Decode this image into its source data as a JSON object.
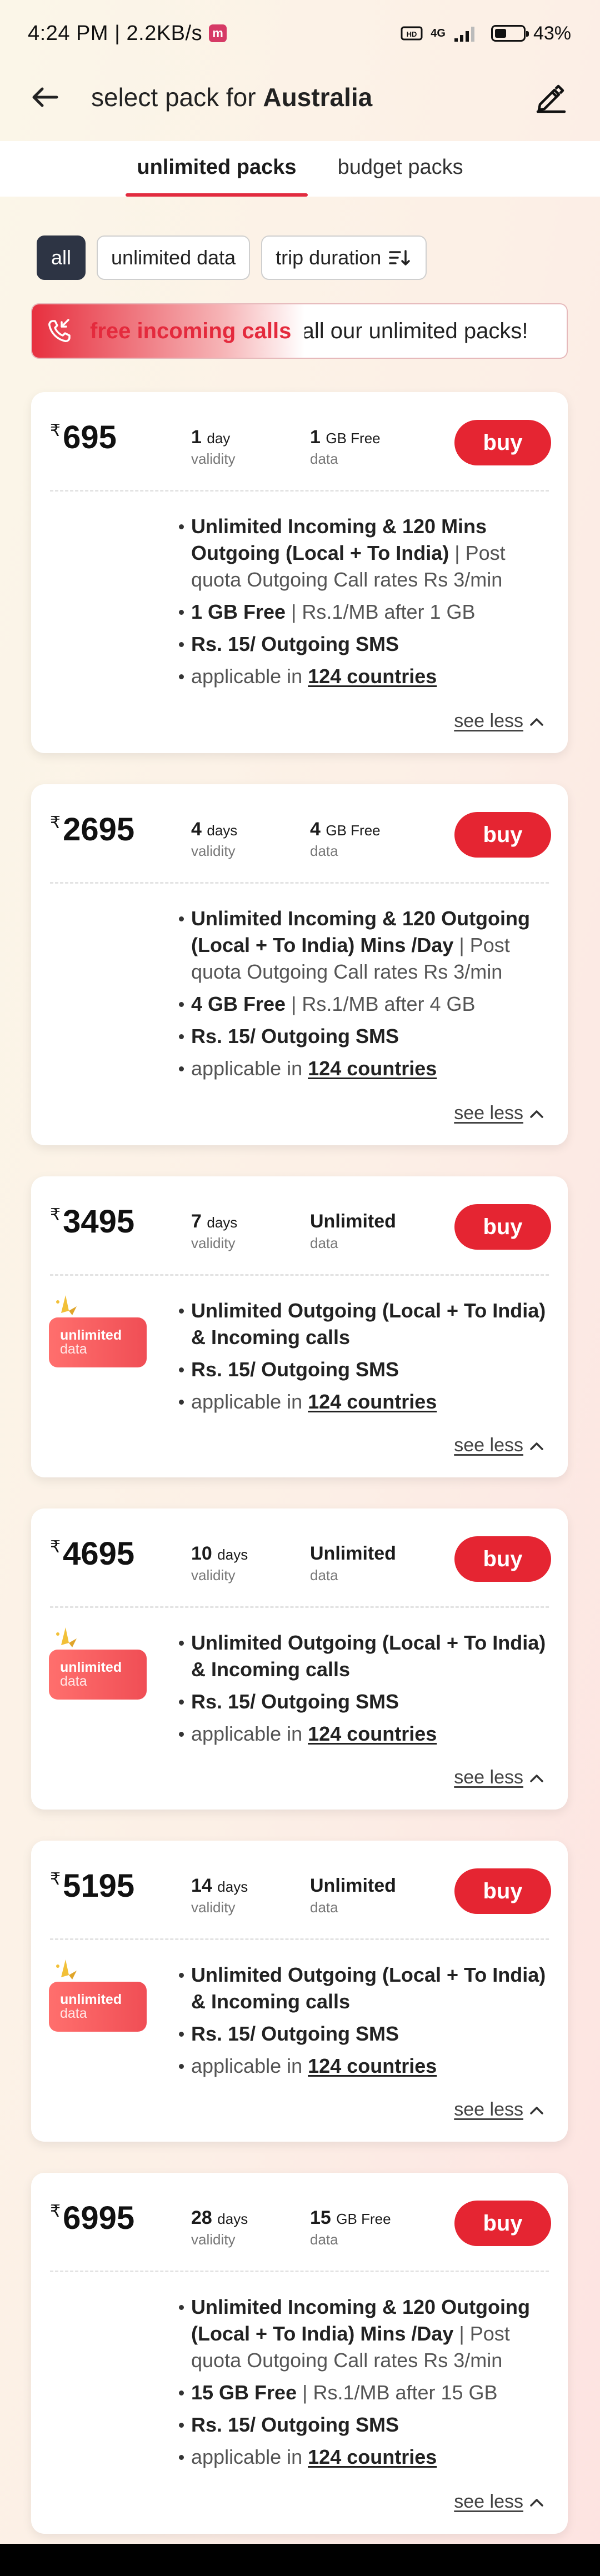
{
  "status": {
    "time": "4:24 PM | 2.2KB/s",
    "app_glyph": "m",
    "network": "4G",
    "battery": "43%"
  },
  "header": {
    "title_prefix": "select pack for ",
    "title_country": "Australia"
  },
  "tabs": [
    {
      "label": "unlimited packs",
      "active": true
    },
    {
      "label": "budget packs",
      "active": false
    }
  ],
  "filters": {
    "all": "all",
    "unlimited_data": "unlimited data",
    "trip_duration": "trip duration"
  },
  "banner": {
    "highlight": "free incoming calls",
    "rest": "on all our unlimited packs!"
  },
  "common": {
    "currency": "₹",
    "buy": "buy",
    "see_less": "see less",
    "validity": "validity",
    "data": "data",
    "applicable_prefix": "applicable in ",
    "countries": "124 countries",
    "badge_line1": "unlimited",
    "badge_line2": "data"
  },
  "packs": [
    {
      "price": "695",
      "validity_num": "1",
      "validity_unit": "day",
      "data_num": "1",
      "data_unit": "GB Free",
      "features": [
        {
          "bold": "Unlimited Incoming & 120 Mins Outgoing (Local + To India)",
          "grey": " | Post quota Outgoing Call rates  Rs 3/min"
        },
        {
          "bold": "1 GB Free",
          "grey": " | Rs.1/MB after 1 GB"
        },
        {
          "bold": "Rs. 15/ Outgoing SMS",
          "grey": ""
        }
      ]
    },
    {
      "price": "2695",
      "validity_num": "4",
      "validity_unit": "days",
      "data_num": "4",
      "data_unit": "GB Free",
      "features": [
        {
          "bold": "Unlimited Incoming & 120 Outgoing (Local + To India) Mins /Day",
          "grey": " | Post quota Outgoing Call rates  Rs 3/min"
        },
        {
          "bold": "4 GB Free",
          "grey": " | Rs.1/MB after 4 GB"
        },
        {
          "bold": "Rs. 15/ Outgoing SMS",
          "grey": ""
        }
      ]
    },
    {
      "price": "3495",
      "validity_num": "7",
      "validity_unit": "days",
      "data_num": "Unlimited",
      "data_unit": "",
      "features": [
        {
          "bold": "Unlimited Outgoing (Local + To India) & Incoming calls",
          "grey": ""
        },
        {
          "bold": "Rs. 15/ Outgoing SMS",
          "grey": ""
        }
      ]
    },
    {
      "price": "4695",
      "validity_num": "10",
      "validity_unit": "days",
      "data_num": "Unlimited",
      "data_unit": "",
      "features": [
        {
          "bold": "Unlimited Outgoing (Local + To India) & Incoming calls",
          "grey": ""
        },
        {
          "bold": "Rs. 15/ Outgoing SMS",
          "grey": ""
        }
      ]
    },
    {
      "price": "5195",
      "validity_num": "14",
      "validity_unit": "days",
      "data_num": "Unlimited",
      "data_unit": "",
      "features": [
        {
          "bold": "Unlimited Outgoing (Local + To India) & Incoming calls",
          "grey": ""
        },
        {
          "bold": "Rs. 15/ Outgoing SMS",
          "grey": ""
        }
      ]
    },
    {
      "price": "6995",
      "validity_num": "28",
      "validity_unit": "days",
      "data_num": "15",
      "data_unit": "GB Free",
      "features": [
        {
          "bold": "Unlimited Incoming & 120 Outgoing (Local + To India) Mins /Day",
          "grey": " | Post quota Outgoing Call rates  Rs 3/min"
        },
        {
          "bold": "15 GB Free",
          "grey": " | Rs.1/MB after 15 GB"
        },
        {
          "bold": "Rs. 15/ Outgoing SMS",
          "grey": ""
        }
      ]
    }
  ],
  "colors": {
    "accent": "#e52532",
    "chip_active": "#2d3444",
    "badge": "#f04e55"
  }
}
